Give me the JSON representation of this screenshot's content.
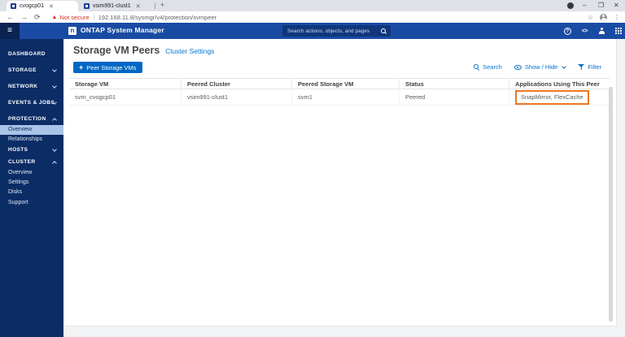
{
  "browser": {
    "tabs": [
      {
        "title": "cvogcp01"
      },
      {
        "title": "vsim991-clust1"
      }
    ],
    "new_tab_label": "+",
    "window_controls": {
      "minimize": "–",
      "restore": "❐",
      "close": "✕"
    },
    "security_label": "Not secure",
    "url": "192.168.11.8/sysmgr/v4/protection/svmpeer"
  },
  "header": {
    "app_title": "ONTAP System Manager",
    "logo_letter": "n",
    "search_placeholder": "Search actions, objects, and pages",
    "dev_icon_label": "<>"
  },
  "sidebar": {
    "items": [
      {
        "label": "DASHBOARD"
      },
      {
        "label": "STORAGE"
      },
      {
        "label": "NETWORK"
      },
      {
        "label": "EVENTS & JOBS"
      },
      {
        "label": "PROTECTION"
      },
      {
        "label": "Overview"
      },
      {
        "label": "Relationships"
      },
      {
        "label": "HOSTS"
      },
      {
        "label": "CLUSTER"
      },
      {
        "label": "Overview"
      },
      {
        "label": "Settings"
      },
      {
        "label": "Disks"
      },
      {
        "label": "Support"
      }
    ]
  },
  "main": {
    "title": "Storage VM Peers",
    "cluster_settings_link": "Cluster Settings",
    "peer_button_label": "Peer Storage VMs",
    "toolbar": {
      "search": "Search",
      "show_hide": "Show / Hide",
      "filter": "Filter"
    },
    "table": {
      "columns": [
        "Storage VM",
        "Peered Cluster",
        "Peered Storage VM",
        "Status",
        "Applications Using This Peer"
      ],
      "row": {
        "storage_vm": "svm_cvogcp01",
        "peered_cluster": "vsim991-clust1",
        "peered_storage_vm": "svm1",
        "status": "Peered",
        "applications": "SnapMirror, FlexCache"
      }
    }
  },
  "colors": {
    "header_blue": "#1a4ba3",
    "sidebar_navy": "#0b2c65",
    "accent_blue": "#0067c5",
    "highlight_orange": "#ED7622",
    "not_secure_red": "#d93025",
    "active_subitem_bg": "#a9c4e8"
  }
}
